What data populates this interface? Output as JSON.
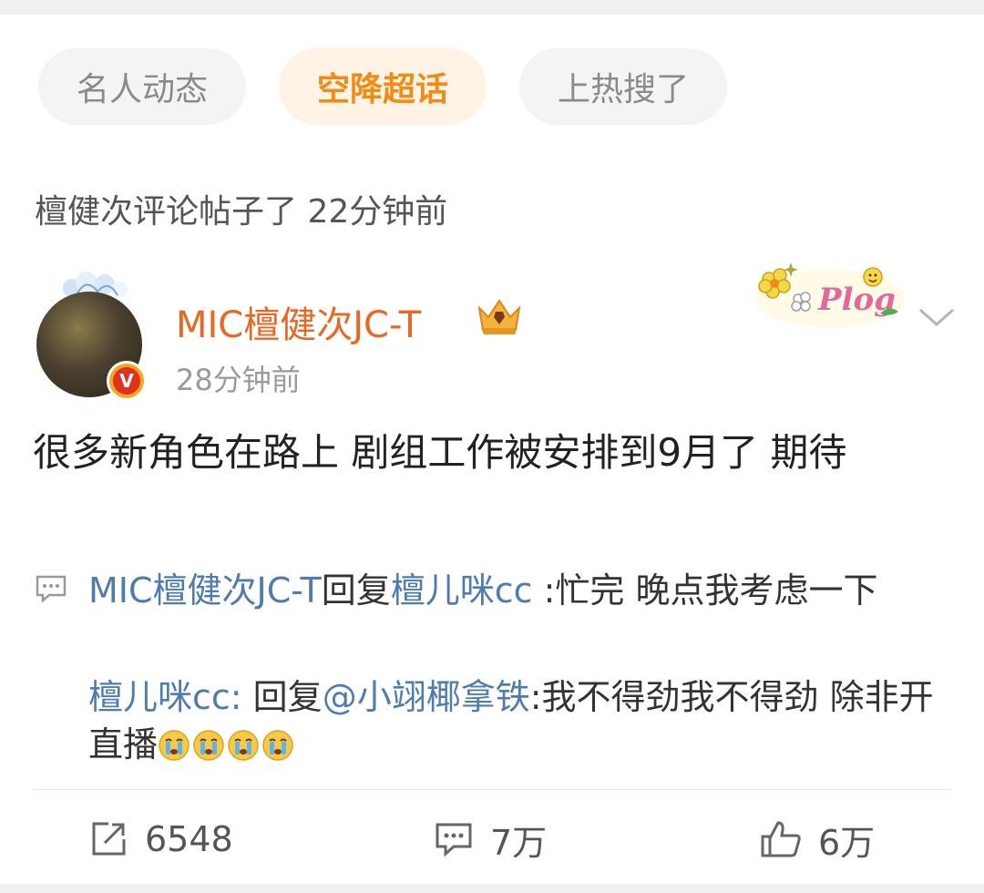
{
  "tags": [
    {
      "label": "名人动态",
      "active": false
    },
    {
      "label": "空降超话",
      "active": true
    },
    {
      "label": "上热搜了",
      "active": false
    }
  ],
  "meta_line": "檀健次评论帖子了 22分钟前",
  "post": {
    "username": "MIC檀健次JC-T",
    "time": "28分钟前",
    "text": "很多新角色在路上 剧组工作被安排到9月了 期待"
  },
  "comments": [
    {
      "author": "MIC檀健次JC-T",
      "reply_word": "回复",
      "target": "檀儿咪cc",
      "text": " :忙完 晚点我考虑一下"
    },
    {
      "author": "檀儿咪cc:",
      "reply_word": " 回复",
      "target": "@小翊椰拿铁",
      "text": ":我不得劲我不得劲 除非开直播",
      "emoji_count": 4
    }
  ],
  "actions": {
    "share_count": "6548",
    "comment_count": "7万",
    "like_count": "6万"
  },
  "colors": {
    "username": "#e86722",
    "link": "#4f7cae",
    "active_tag_text": "#f08c16",
    "active_tag_bg": "#fff3e6"
  },
  "icons": [
    "crown-icon",
    "plog-badge-icon",
    "chevron-down-icon",
    "comment-bubble-icon",
    "share-icon",
    "comment-icon",
    "thumbs-up-icon",
    "crying-emoji-icon",
    "verified-badge-icon"
  ]
}
